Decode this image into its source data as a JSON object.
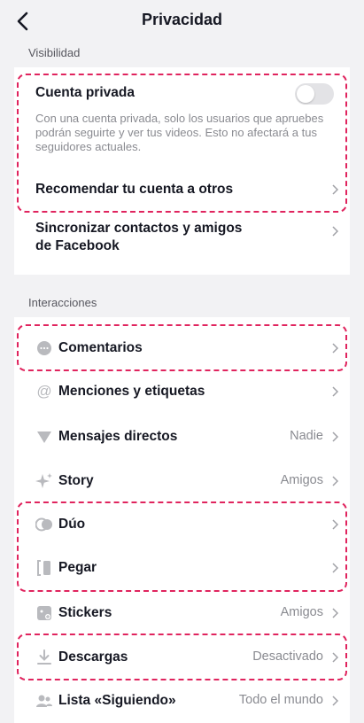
{
  "header": {
    "title": "Privacidad"
  },
  "visibility": {
    "label": "Visibilidad",
    "private_title": "Cuenta privada",
    "private_desc": "Con una cuenta privada, solo los usuarios que apruebes podrán seguirte y ver tus videos. Esto no afectará a tus seguidores actuales.",
    "private_enabled": false,
    "recommend": "Recomendar tu cuenta a otros",
    "sync_line1": "Sincronizar contactos y amigos",
    "sync_line2": "de Facebook"
  },
  "interactions": {
    "label": "Interacciones",
    "items": [
      {
        "label": "Comentarios",
        "value": "",
        "icon": "comment-icon"
      },
      {
        "label": "Menciones y etiquetas",
        "value": "",
        "icon": "at-sign-icon"
      },
      {
        "label": "Mensajes directos",
        "value": "Nadie",
        "icon": "message-icon"
      },
      {
        "label": "Story",
        "value": "Amigos",
        "icon": "sparkle-icon"
      },
      {
        "label": "Dúo",
        "value": "",
        "icon": "duet-icon"
      },
      {
        "label": "Pegar",
        "value": "",
        "icon": "stitch-icon"
      },
      {
        "label": "Stickers",
        "value": "Amigos",
        "icon": "sticker-icon"
      },
      {
        "label": "Descargas",
        "value": "Desactivado",
        "icon": "download-icon"
      },
      {
        "label": "Lista «Siguiendo»",
        "value": "Todo el mundo",
        "icon": "following-list-icon"
      }
    ]
  },
  "colors": {
    "highlight": "#e0245e",
    "background": "#f2f2f4",
    "card": "#ffffff"
  }
}
